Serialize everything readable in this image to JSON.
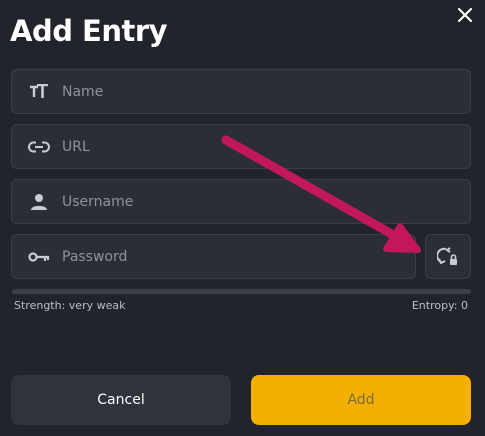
{
  "dialog": {
    "title": "Add Entry",
    "close_icon": "close-icon"
  },
  "fields": {
    "name": {
      "placeholder": "Name",
      "value": "",
      "icon": "text-format-icon"
    },
    "url": {
      "placeholder": "URL",
      "value": "",
      "icon": "link-icon"
    },
    "username": {
      "placeholder": "Username",
      "value": "",
      "icon": "person-icon"
    },
    "password": {
      "placeholder": "Password",
      "value": "",
      "icon": "key-icon"
    }
  },
  "generate_button": {
    "icon": "password-generate-icon"
  },
  "strength": {
    "label": "Strength: very weak",
    "entropy_label": "Entropy: 0",
    "fill_fraction": 0
  },
  "buttons": {
    "cancel_label": "Cancel",
    "add_label": "Add"
  },
  "colors": {
    "background": "#21242b",
    "field_bg": "#2b2e36",
    "accent": "#f4b000",
    "annotation_arrow": "#c2185b"
  }
}
